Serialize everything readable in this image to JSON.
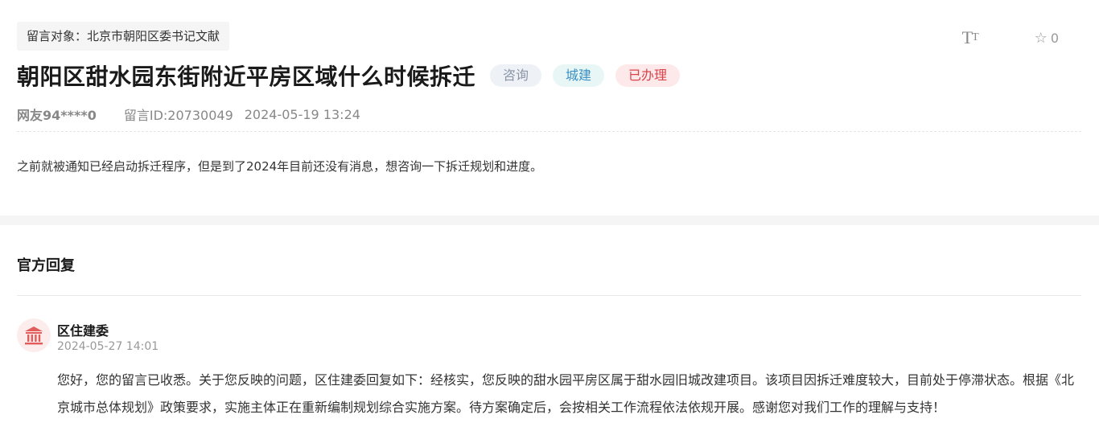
{
  "message": {
    "target": "留言对象：北京市朝阳区委书记文献",
    "title": "朝阳区甜水园东街附近平房区域什么时候拆迁",
    "tags": [
      {
        "label": "咨询",
        "color": "#8a95a6"
      },
      {
        "label": "城建",
        "color": "#3b8fc4"
      },
      {
        "label": "已办理",
        "color": "#d9434a"
      }
    ],
    "author": "网友94****0",
    "id_text": "留言ID:20730049",
    "datetime": "2024-05-19 13:24",
    "content": "之前就被通知已经启动拆迁程序，但是到了2024年目前还没有消息，想咨询一下拆迁规划和进度。"
  },
  "toolbar": {
    "font_size_icon": "font-size-icon",
    "favorite_icon": "star-outline-icon",
    "favorite_count": "0"
  },
  "reply": {
    "section_title": "官方回复",
    "avatar_icon": "government-building-icon",
    "org": "区住建委",
    "time": "2024-05-27 14:01",
    "body": "您好，您的留言已收悉。关于您反映的问题，区住建委回复如下：经核实，您反映的甜水园平房区属于甜水园旧城改建项目。该项目因拆迁难度较大，目前处于停滞状态。根据《北京城市总体规划》政策要求，实施主体正在重新编制规划综合实施方案。待方案确定后，会按相关工作流程依法依规开展。感谢您对我们工作的理解与支持！"
  },
  "colors": {
    "accent_red": "#d9434a",
    "tag_blue": "#3b8fc4",
    "tag_gray": "#8a95a6",
    "band_gray": "#f5f5f5"
  }
}
